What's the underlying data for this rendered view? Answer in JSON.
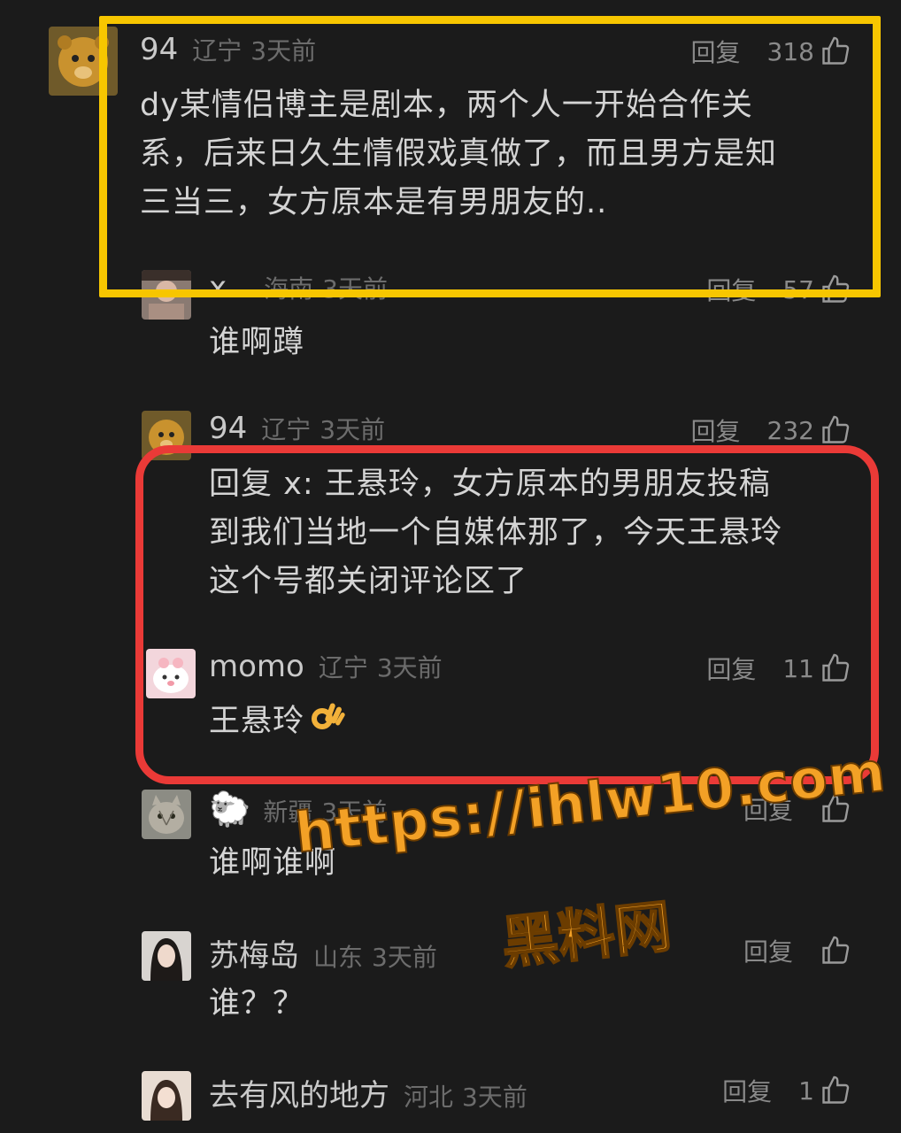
{
  "comments": [
    {
      "name": "94",
      "location": "辽宁",
      "time": "3天前",
      "reply": "回复",
      "likes": "318",
      "text": [
        "dy某情侣博主是剧本，两个人一开始合作关",
        "系，后来日久生情假戏真做了，而且男方是知",
        "三当三，女方原本是有男朋友的.."
      ]
    },
    {
      "name": "x",
      "location": "海南",
      "time": "3天前",
      "reply": "回复",
      "likes": "57",
      "text": [
        "谁啊蹲"
      ]
    },
    {
      "name": "94",
      "location": "辽宁",
      "time": "3天前",
      "reply": "回复",
      "likes": "232",
      "text": [
        "回复 x: 王悬玲，女方原本的男朋友投稿",
        "到我们当地一个自媒体那了，今天王悬玲",
        "这个号都关闭评论区了"
      ]
    },
    {
      "name": "momo",
      "location": "辽宁",
      "time": "3天前",
      "reply": "回复",
      "likes": "11",
      "text": [
        "王悬玲"
      ]
    },
    {
      "name": "🐑",
      "location": "新疆",
      "time": "3天前",
      "reply": "回复",
      "likes": "",
      "text": [
        "谁啊谁啊"
      ]
    },
    {
      "name": "苏梅岛",
      "location": "山东",
      "time": "3天前",
      "reply": "回复",
      "likes": "",
      "text": [
        "谁？？"
      ]
    },
    {
      "name": "去有风的地方",
      "location": "河北",
      "time": "3天前",
      "reply": "回复",
      "likes": "1",
      "text": []
    }
  ],
  "watermark": {
    "url": "https://ihlw10.com",
    "site": "黑料网"
  },
  "colors": {
    "highlight_yellow": "#f7c600",
    "highlight_red": "#ea3a37",
    "watermark": "#f3a126"
  }
}
